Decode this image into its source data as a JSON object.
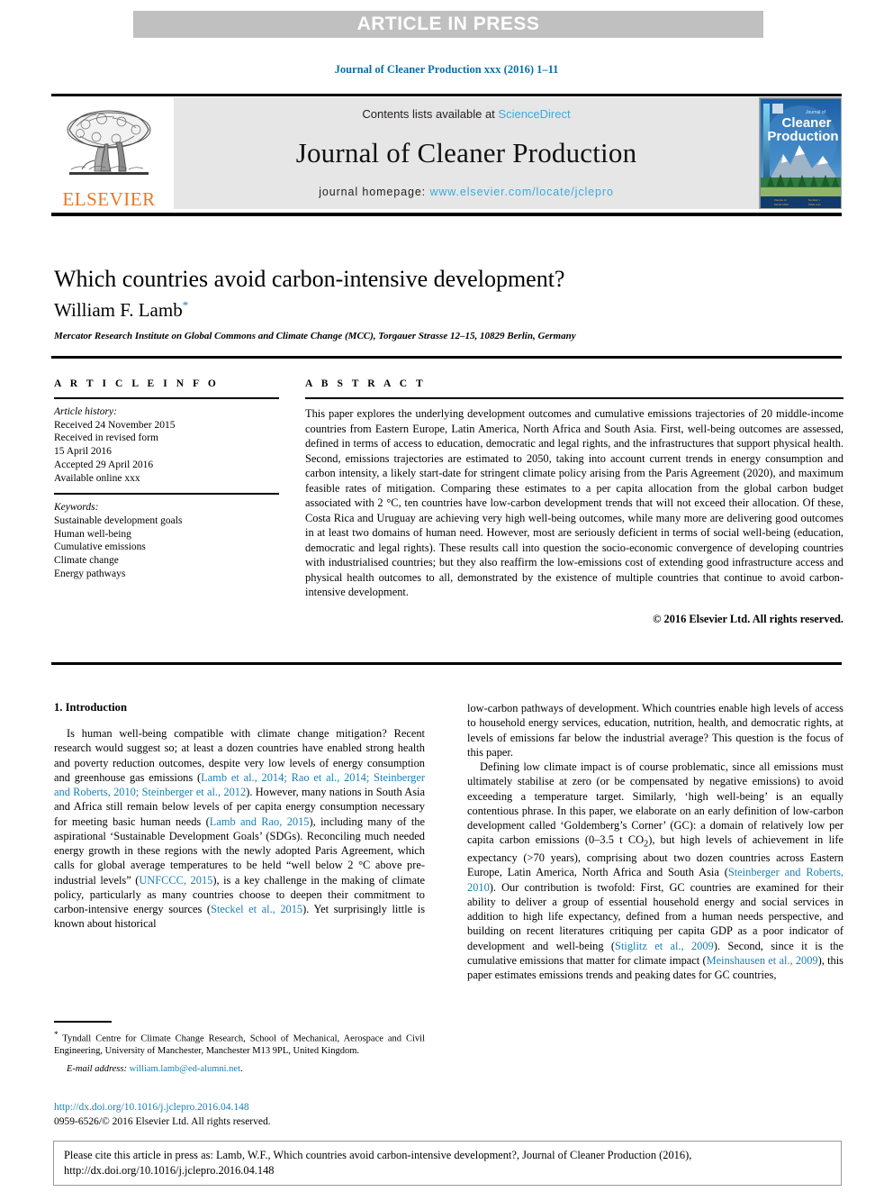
{
  "banner": {
    "text": "ARTICLE IN PRESS",
    "bg_color": "#c0c0c0",
    "text_color": "#ffffff"
  },
  "running_head": "Journal of Cleaner Production xxx (2016) 1–11",
  "masthead": {
    "publisher": "ELSEVIER",
    "publisher_color": "#e87722",
    "contents_prefix": "Contents lists available at ",
    "contents_link": "ScienceDirect",
    "journal_name": "Journal of Cleaner Production",
    "homepage_prefix": "journal homepage: ",
    "homepage_url": "www.elsevier.com/locate/jclepro",
    "link_color": "#3aaadc",
    "cover": {
      "line1": "Journal of",
      "line2": "Cleaner",
      "line3": "Production"
    }
  },
  "article": {
    "title": "Which countries avoid carbon-intensive development?",
    "author": "William F. Lamb",
    "author_marker": "*",
    "affiliation": "Mercator Research Institute on Global Commons and Climate Change (MCC), Torgauer Strasse 12–15, 10829 Berlin, Germany"
  },
  "article_info": {
    "heading": "A R T I C L E   I N F O",
    "history_label": "Article history:",
    "history": [
      "Received 24 November 2015",
      "Received in revised form",
      "15 April 2016",
      "Accepted 29 April 2016",
      "Available online xxx"
    ],
    "keywords_label": "Keywords:",
    "keywords": [
      "Sustainable development goals",
      "Human well-being",
      "Cumulative emissions",
      "Climate change",
      "Energy pathways"
    ]
  },
  "abstract": {
    "heading": "A B S T R A C T",
    "text": "This paper explores the underlying development outcomes and cumulative emissions trajectories of 20 middle-income countries from Eastern Europe, Latin America, North Africa and South Asia. First, well-being outcomes are assessed, defined in terms of access to education, democratic and legal rights, and the infrastructures that support physical health. Second, emissions trajectories are estimated to 2050, taking into account current trends in energy consumption and carbon intensity, a likely start-date for stringent climate policy arising from the Paris Agreement (2020), and maximum feasible rates of mitigation. Comparing these estimates to a per capita allocation from the global carbon budget associated with 2 °C, ten countries have low-carbon development trends that will not exceed their allocation. Of these, Costa Rica and Uruguay are achieving very high well-being outcomes, while many more are delivering good outcomes in at least two domains of human need. However, most are seriously deficient in terms of social well-being (education, democratic and legal rights). These results call into question the socio-economic convergence of developing countries with industrialised countries; but they also reaffirm the low-emissions cost of extending good infrastructure access and physical health outcomes to all, demonstrated by the existence of multiple countries that continue to avoid carbon-intensive development.",
    "copyright": "© 2016 Elsevier Ltd. All rights reserved."
  },
  "body": {
    "section_heading": "1. Introduction",
    "left_paragraph_1": {
      "seg1": "Is human well-being compatible with climate change mitigation? Recent research would suggest so; at least a dozen countries have enabled strong health and poverty reduction outcomes, despite very low levels of energy consumption and greenhouse gas emissions (",
      "ref1": "Lamb et al., 2014; Rao et al., 2014; Steinberger and Roberts, 2010; Steinberger et al., 2012",
      "seg2": "). However, many nations in South Asia and Africa still remain below levels of per capita energy consumption necessary for meeting basic human needs (",
      "ref2": "Lamb and Rao, 2015",
      "seg3": "), including many of the aspirational ‘Sustainable Development Goals’ (SDGs). Reconciling much needed energy growth in these regions with the newly adopted Paris Agreement, which calls for global average temperatures to be held “well below 2 °C above pre-industrial levels” (",
      "ref3": "UNFCCC, 2015",
      "seg4": "), is a key challenge in the making of climate policy, particularly as many countries choose to deepen their commitment to carbon-intensive energy sources (",
      "ref4": "Steckel et al., 2015",
      "seg5": "). Yet surprisingly little is known about historical"
    },
    "right_paragraph_1": "low-carbon pathways of development. Which countries enable high levels of access to household energy services, education, nutrition, health, and democratic rights, at levels of emissions far below the industrial average? This question is the focus of this paper.",
    "right_paragraph_2": {
      "seg1": "Defining low climate impact is of course problematic, since all emissions must ultimately stabilise at zero (or be compensated by negative emissions) to avoid exceeding a temperature target. Similarly, ‘high well-being’ is an equally contentious phrase. In this paper, we elaborate on an early definition of low-carbon development called ‘Goldemberg’s Corner’ (GC): a domain of relatively low per capita carbon emissions (0–3.5 t CO",
      "sub1": "2",
      "seg2": "), but high levels of achievement in life expectancy (>70 years), comprising about two dozen countries across Eastern Europe, Latin America, North Africa and South Asia (",
      "ref1": "Steinberger and Roberts, 2010",
      "seg3": "). Our contribution is twofold: First, GC countries are examined for their ability to deliver a group of essential household energy and social services in addition to high life expectancy, defined from a human needs perspective, and building on recent literatures critiquing per capita GDP as a poor indicator of development and well-being (",
      "ref2": "Stiglitz et al., 2009",
      "seg4": "). Second, since it is the cumulative emissions that matter for climate impact (",
      "ref3": "Meinshausen et al., 2009",
      "seg5": "), this paper estimates emissions trends and peaking dates for GC countries,"
    }
  },
  "footnote": {
    "marker": "*",
    "text": "Tyndall Centre for Climate Change Research, School of Mechanical, Aerospace and Civil Engineering, University of Manchester, Manchester M13 9PL, United Kingdom.",
    "email_label": "E-mail address:",
    "email": "william.lamb@ed-alumni.net"
  },
  "doi_block": {
    "doi_url": "http://dx.doi.org/10.1016/j.jclepro.2016.04.148",
    "issn_line": "0959-6526/© 2016 Elsevier Ltd. All rights reserved."
  },
  "cite_box": {
    "line1": "Please cite this article in press as: Lamb, W.F., Which countries avoid carbon-intensive development?, Journal of Cleaner Production (2016),",
    "line2": "http://dx.doi.org/10.1016/j.jclepro.2016.04.148"
  },
  "colors": {
    "link_blue": "#1a7fb5",
    "sciencedirect_blue": "#3aaadc",
    "elsevier_orange": "#e87722",
    "banner_gray": "#c0c0c0",
    "masthead_gray": "#e6e6e6"
  }
}
